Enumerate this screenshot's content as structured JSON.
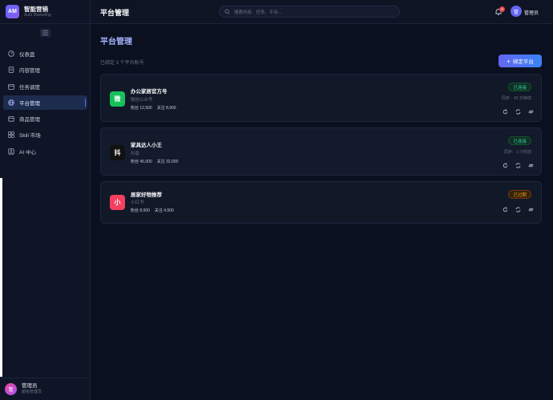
{
  "brand": {
    "logo": "AM",
    "name": "智能营销",
    "subtitle": "Auto Marketing"
  },
  "sidebar": {
    "items": [
      {
        "label": "仪表盘",
        "icon": "dashboard-icon"
      },
      {
        "label": "内容管理",
        "icon": "document-icon"
      },
      {
        "label": "任务调度",
        "icon": "calendar-icon"
      },
      {
        "label": "平台管理",
        "icon": "globe-icon",
        "active": true
      },
      {
        "label": "商品管理",
        "icon": "box-icon"
      },
      {
        "label": "Skill 市场",
        "icon": "grid-icon"
      },
      {
        "label": "AI 中心",
        "icon": "ai-icon"
      }
    ],
    "user": {
      "avatar": "管",
      "name": "管理员",
      "role": "超级管理员"
    }
  },
  "topbar": {
    "title": "平台管理",
    "search_placeholder": "搜索内容、任务、平台...",
    "notification_count": "3",
    "avatar": "管",
    "user": "管理员"
  },
  "main": {
    "title": "平台管理",
    "subinfo": "已绑定 3 个平台账号",
    "bind_button": "绑定平台",
    "cards": [
      {
        "icon_text": "微",
        "icon_color": "#16c15a",
        "name": "办公家居官方号",
        "type": "微信公众号",
        "fans": "粉丝 12,500",
        "follows": "关注 8,900",
        "status": "已连接",
        "status_kind": "ok",
        "sync": "同步：42 分钟前"
      },
      {
        "icon_text": "抖",
        "icon_color": "#111111",
        "name": "家具达人小王",
        "type": "抖音",
        "fans": "粉丝 45,000",
        "follows": "关注 32,000",
        "status": "已连接",
        "status_kind": "ok",
        "sync": "同步：1 小时前"
      },
      {
        "icon_text": "小",
        "icon_color": "#f43f5e",
        "name": "居家好物推荐",
        "type": "小红书",
        "fans": "粉丝 8,900",
        "follows": "关注 4,500",
        "status": "已过期",
        "status_kind": "warn",
        "sync": ""
      }
    ]
  },
  "colors": {
    "accent": "#6366f1",
    "success": "#34d399",
    "warning": "#f59e0b",
    "danger": "#ef4444"
  }
}
